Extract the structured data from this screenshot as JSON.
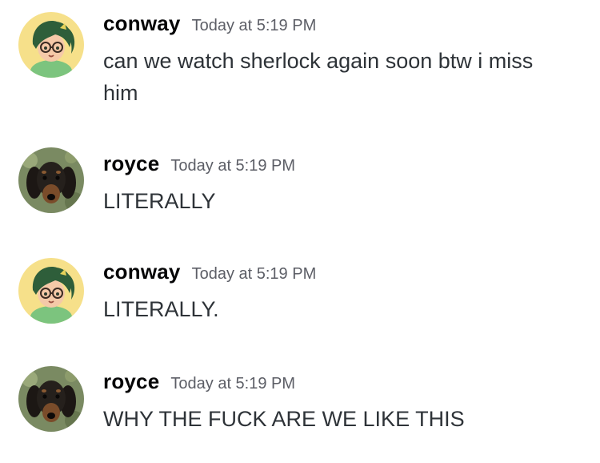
{
  "messages": [
    {
      "author": "conway",
      "timestamp": "Today at 5:19 PM",
      "text": "can we watch sherlock again soon btw i miss him",
      "avatar_icon": "anime-character-avatar-icon"
    },
    {
      "author": "royce",
      "timestamp": "Today at 5:19 PM",
      "text": "LITERALLY",
      "avatar_icon": "dog-avatar-icon"
    },
    {
      "author": "conway",
      "timestamp": "Today at 5:19 PM",
      "text": "LITERALLY.",
      "avatar_icon": "anime-character-avatar-icon"
    },
    {
      "author": "royce",
      "timestamp": "Today at 5:19 PM",
      "text": "WHY THE FUCK ARE WE LIKE THIS",
      "avatar_icon": "dog-avatar-icon"
    }
  ],
  "colors": {
    "username": "#060607",
    "timestamp": "#5c5e66",
    "message_text": "#2e3338",
    "background": "#ffffff"
  }
}
